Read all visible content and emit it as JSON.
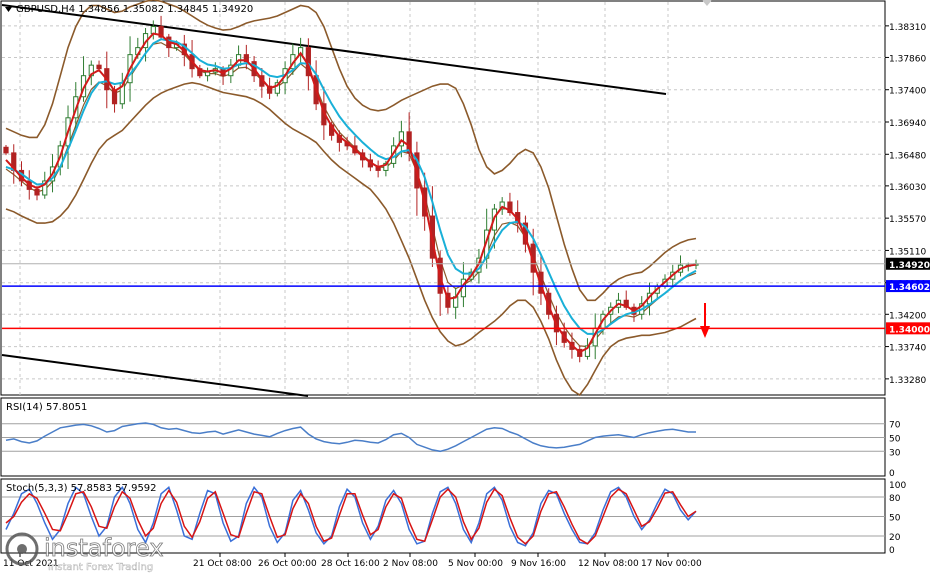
{
  "main": {
    "header": "GBPUSD,H4  1.34856 1.35082 1.34845 1.34920",
    "ylim": [
      1.3305,
      1.3865
    ],
    "price_labels": [
      "1.38310",
      "1.37860",
      "1.37400",
      "1.36940",
      "1.36480",
      "1.36030",
      "1.35570",
      "1.35110",
      "1.34650",
      "1.34200",
      "1.33740",
      "1.33280"
    ],
    "price_values": [
      1.3831,
      1.3786,
      1.374,
      1.3694,
      1.3648,
      1.3603,
      1.3557,
      1.3511,
      1.3465,
      1.342,
      1.3374,
      1.3328
    ],
    "current_label": "1.34920",
    "current_value": 1.3492,
    "level_blue_label": "1.34602",
    "level_blue_value": 1.34602,
    "level_red_label": "1.34000",
    "level_red_value": 1.34,
    "x_labels": [
      "11 Oct 2021",
      "21 Oct 08:00",
      "26 Oct 00:00",
      "28 Oct 16:00",
      "2 Nov 08:00",
      "5 Nov 00:00",
      "9 Nov 16:00",
      "12 Nov 08:00",
      "17 Nov 00:00"
    ],
    "colors": {
      "up": "#2f7d32",
      "down": "#b22222",
      "ma_fast": "#d11a1a",
      "ma_slow": "#19b0d8",
      "bands": "#8b5a2b",
      "blue_line": "#0000ff",
      "red_line": "#ff0000",
      "trend": "#000000"
    }
  },
  "rsi": {
    "header": "RSI(14) 57.8051",
    "ylim": [
      0,
      100
    ],
    "levels": [
      "70",
      "50",
      "30",
      "0"
    ],
    "color": "#4a7ec8"
  },
  "stoch": {
    "header": "Stoch(5,3,3) 57.8583 57.9592",
    "ylim": [
      0,
      100
    ],
    "levels": [
      "100",
      "80",
      "50",
      "20",
      "0"
    ],
    "main_color": "#3a6fd8",
    "signal_color": "#d81414"
  },
  "watermark": {
    "brand": "instaforex",
    "tagline": "Instant Forex Trading"
  },
  "chart_data": {
    "type": "candlestick",
    "instrument": "GBPUSD",
    "timeframe": "H4",
    "ohlc_last": {
      "open": 1.34856,
      "high": 1.35082,
      "low": 1.34845,
      "close": 1.3492
    },
    "categories": [
      "11 Oct 2021",
      "21 Oct 08:00",
      "26 Oct 00:00",
      "28 Oct 16:00",
      "2 Nov 08:00",
      "5 Nov 00:00",
      "9 Nov 16:00",
      "12 Nov 08:00",
      "17 Nov 00:00"
    ],
    "close_series": [
      1.365,
      1.3625,
      1.361,
      1.3598,
      1.359,
      1.361,
      1.363,
      1.366,
      1.37,
      1.373,
      1.376,
      1.3775,
      1.377,
      1.374,
      1.372,
      1.375,
      1.379,
      1.38,
      1.382,
      1.383,
      1.3815,
      1.38,
      1.3805,
      1.379,
      1.377,
      1.376,
      1.3765,
      1.377,
      1.376,
      1.3775,
      1.379,
      1.378,
      1.376,
      1.3745,
      1.3735,
      1.375,
      1.377,
      1.379,
      1.38,
      1.376,
      1.372,
      1.369,
      1.3675,
      1.3665,
      1.366,
      1.365,
      1.364,
      1.363,
      1.3625,
      1.3635,
      1.366,
      1.368,
      1.365,
      1.36,
      1.356,
      1.35,
      1.345,
      1.343,
      1.3445,
      1.347,
      1.348,
      1.35,
      1.354,
      1.357,
      1.358,
      1.3565,
      1.355,
      1.352,
      1.348,
      1.345,
      1.342,
      1.3395,
      1.338,
      1.337,
      1.336,
      1.3375,
      1.34,
      1.342,
      1.343,
      1.344,
      1.343,
      1.342,
      1.3435,
      1.345,
      1.346,
      1.347,
      1.348,
      1.349,
      1.349,
      1.3492
    ],
    "ma_fast": [
      1.364,
      1.3628,
      1.3615,
      1.3605,
      1.36,
      1.3605,
      1.362,
      1.3645,
      1.368,
      1.3712,
      1.3742,
      1.3762,
      1.3768,
      1.3755,
      1.3738,
      1.3745,
      1.377,
      1.379,
      1.3808,
      1.382,
      1.3818,
      1.3808,
      1.3805,
      1.3795,
      1.378,
      1.3768,
      1.3766,
      1.3768,
      1.3764,
      1.377,
      1.3782,
      1.3782,
      1.377,
      1.3755,
      1.3742,
      1.3746,
      1.376,
      1.3778,
      1.3792,
      1.3775,
      1.374,
      1.3708,
      1.3688,
      1.3673,
      1.3665,
      1.3655,
      1.3645,
      1.3636,
      1.363,
      1.3633,
      1.365,
      1.3668,
      1.366,
      1.3622,
      1.358,
      1.3525,
      1.3472,
      1.3442,
      1.3444,
      1.3462,
      1.3475,
      1.3492,
      1.3525,
      1.3558,
      1.3573,
      1.3568,
      1.3556,
      1.353,
      1.3495,
      1.3462,
      1.3432,
      1.3405,
      1.3388,
      1.3376,
      1.3366,
      1.3372,
      1.3392,
      1.3412,
      1.3425,
      1.3435,
      1.3432,
      1.3425,
      1.3432,
      1.3445,
      1.3456,
      1.3466,
      1.3476,
      1.3485,
      1.3489,
      1.3491
    ],
    "ma_slow": [
      1.363,
      1.3626,
      1.362,
      1.3612,
      1.3605,
      1.3606,
      1.3614,
      1.363,
      1.3655,
      1.3682,
      1.371,
      1.3735,
      1.375,
      1.3752,
      1.3748,
      1.375,
      1.3762,
      1.3776,
      1.3792,
      1.3806,
      1.3812,
      1.381,
      1.3808,
      1.3802,
      1.3792,
      1.3782,
      1.3776,
      1.3774,
      1.377,
      1.3771,
      1.3776,
      1.3778,
      1.3775,
      1.3768,
      1.376,
      1.3758,
      1.3761,
      1.3768,
      1.3778,
      1.3777,
      1.3762,
      1.374,
      1.372,
      1.3702,
      1.3688,
      1.3676,
      1.3665,
      1.3655,
      1.3646,
      1.3641,
      1.3644,
      1.3652,
      1.3654,
      1.364,
      1.3615,
      1.358,
      1.354,
      1.3505,
      1.3485,
      1.3478,
      1.3478,
      1.3485,
      1.3502,
      1.3522,
      1.354,
      1.355,
      1.3552,
      1.3545,
      1.3528,
      1.3505,
      1.348,
      1.3455,
      1.3432,
      1.3414,
      1.34,
      1.3392,
      1.3392,
      1.3398,
      1.3406,
      1.3414,
      1.342,
      1.3423,
      1.3427,
      1.3434,
      1.3442,
      1.345,
      1.3459,
      1.3468,
      1.3476,
      1.3482
    ],
    "bands_upper": [
      1.3685,
      1.368,
      1.3675,
      1.3672,
      1.3672,
      1.369,
      1.372,
      1.376,
      1.38,
      1.383,
      1.385,
      1.386,
      1.386,
      1.3855,
      1.385,
      1.3852,
      1.3858,
      1.3862,
      1.3866,
      1.3868,
      1.3866,
      1.3862,
      1.3858,
      1.3852,
      1.3845,
      1.3838,
      1.3832,
      1.3828,
      1.3825,
      1.3826,
      1.383,
      1.3835,
      1.3838,
      1.384,
      1.3842,
      1.3845,
      1.385,
      1.3855,
      1.386,
      1.3858,
      1.385,
      1.383,
      1.38,
      1.377,
      1.3745,
      1.3728,
      1.3718,
      1.3712,
      1.371,
      1.3712,
      1.3718,
      1.3725,
      1.373,
      1.3735,
      1.374,
      1.3745,
      1.3748,
      1.3748,
      1.3742,
      1.372,
      1.369,
      1.3655,
      1.363,
      1.362,
      1.3625,
      1.3635,
      1.3648,
      1.3655,
      1.365,
      1.363,
      1.36,
      1.356,
      1.352,
      1.3485,
      1.3455,
      1.344,
      1.344,
      1.345,
      1.3462,
      1.347,
      1.3475,
      1.3478,
      1.348,
      1.3488,
      1.3498,
      1.3508,
      1.3516,
      1.3522,
      1.3526,
      1.3528
    ],
    "bands_lower": [
      1.357,
      1.3566,
      1.356,
      1.3555,
      1.355,
      1.355,
      1.3552,
      1.356,
      1.3572,
      1.359,
      1.3612,
      1.3635,
      1.3655,
      1.3668,
      1.3675,
      1.3682,
      1.3694,
      1.3706,
      1.3718,
      1.3728,
      1.3735,
      1.374,
      1.3744,
      1.3748,
      1.375,
      1.3748,
      1.3744,
      1.374,
      1.3736,
      1.3734,
      1.3732,
      1.373,
      1.3726,
      1.372,
      1.3712,
      1.3702,
      1.3692,
      1.3684,
      1.3678,
      1.3672,
      1.3665,
      1.3652,
      1.364,
      1.363,
      1.3622,
      1.3614,
      1.3606,
      1.3598,
      1.3585,
      1.357,
      1.355,
      1.3525,
      1.35,
      1.347,
      1.344,
      1.3415,
      1.3395,
      1.3382,
      1.3375,
      1.3378,
      1.3385,
      1.3394,
      1.3402,
      1.341,
      1.342,
      1.3432,
      1.344,
      1.344,
      1.343,
      1.341,
      1.3385,
      1.3355,
      1.333,
      1.3312,
      1.3305,
      1.332,
      1.334,
      1.336,
      1.3374,
      1.3382,
      1.3386,
      1.3388,
      1.339,
      1.339,
      1.3392,
      1.3394,
      1.3398,
      1.3402,
      1.3408,
      1.3414
    ],
    "rsi_series": [
      46,
      48,
      44,
      42,
      45,
      52,
      58,
      64,
      66,
      68,
      69,
      67,
      63,
      58,
      60,
      66,
      68,
      70,
      71,
      69,
      64,
      62,
      63,
      60,
      57,
      56,
      58,
      59,
      55,
      58,
      61,
      58,
      55,
      53,
      51,
      56,
      60,
      63,
      65,
      55,
      48,
      44,
      42,
      41,
      43,
      46,
      45,
      43,
      42,
      47,
      54,
      56,
      50,
      40,
      36,
      32,
      30,
      33,
      38,
      44,
      50,
      56,
      62,
      64,
      63,
      58,
      54,
      48,
      42,
      38,
      36,
      35,
      36,
      38,
      40,
      45,
      50,
      52,
      53,
      54,
      52,
      50,
      54,
      57,
      59,
      61,
      62,
      60,
      58,
      58
    ],
    "stoch_main": [
      30,
      55,
      85,
      92,
      70,
      40,
      15,
      30,
      70,
      95,
      85,
      50,
      20,
      35,
      80,
      95,
      70,
      30,
      10,
      40,
      85,
      95,
      60,
      20,
      15,
      55,
      90,
      85,
      40,
      12,
      20,
      70,
      95,
      80,
      35,
      10,
      25,
      75,
      90,
      60,
      25,
      8,
      20,
      65,
      92,
      80,
      40,
      15,
      35,
      75,
      90,
      70,
      30,
      8,
      12,
      55,
      88,
      95,
      70,
      30,
      10,
      40,
      85,
      95,
      75,
      35,
      10,
      5,
      25,
      70,
      90,
      85,
      55,
      30,
      10,
      8,
      25,
      60,
      88,
      95,
      80,
      50,
      30,
      45,
      70,
      92,
      85,
      60,
      45,
      58
    ],
    "stoch_signal": [
      40,
      50,
      72,
      85,
      78,
      55,
      30,
      28,
      55,
      85,
      88,
      65,
      35,
      32,
      65,
      88,
      78,
      45,
      20,
      32,
      70,
      90,
      72,
      35,
      18,
      42,
      78,
      88,
      55,
      22,
      18,
      55,
      88,
      85,
      50,
      18,
      22,
      62,
      85,
      70,
      35,
      12,
      17,
      52,
      85,
      85,
      52,
      22,
      30,
      65,
      85,
      78,
      42,
      15,
      12,
      45,
      80,
      92,
      80,
      42,
      15,
      32,
      72,
      92,
      82,
      48,
      18,
      8,
      20,
      58,
      85,
      88,
      65,
      38,
      15,
      8,
      20,
      50,
      80,
      92,
      85,
      60,
      35,
      42,
      62,
      86,
      88,
      68,
      50,
      58
    ]
  }
}
